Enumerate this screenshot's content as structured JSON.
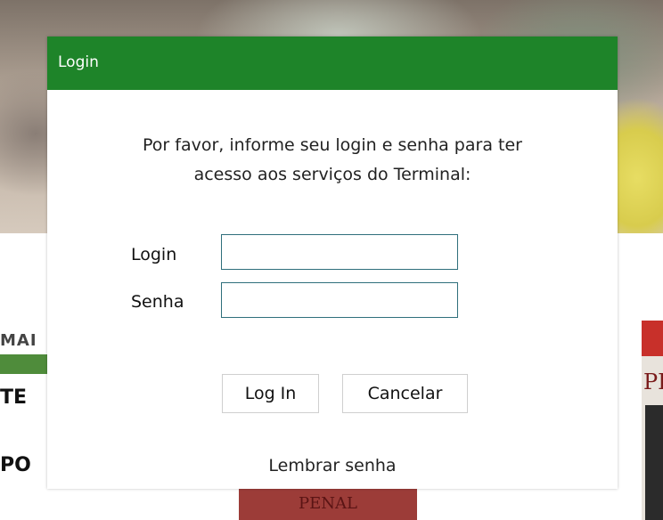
{
  "dialog": {
    "title": "Login",
    "message_line1": "Por favor, informe seu login e senha para ter",
    "message_line2": "acesso aos serviços do Terminal:",
    "fields": {
      "login_label": "Login",
      "login_value": "",
      "senha_label": "Senha",
      "senha_value": ""
    },
    "buttons": {
      "login": "Log In",
      "cancel": "Cancelar"
    },
    "remember_link": "Lembrar senha"
  },
  "colors": {
    "header": "#1e8429",
    "input_border": "#2f6f7c"
  },
  "background": {
    "bottom_book_text": "PENAL",
    "right_book_text": "PI"
  }
}
